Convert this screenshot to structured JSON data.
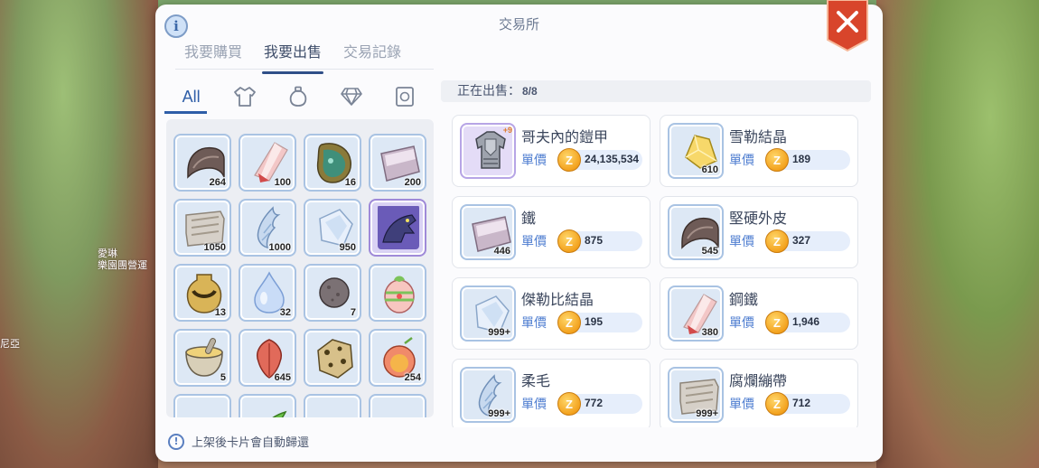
{
  "background": {
    "npc_name": "愛琳",
    "npc_guild": "樂園團營運",
    "left_edge_text": "尼亞"
  },
  "dialog": {
    "title": "交易所",
    "info_icon": "i",
    "close_icon": "×"
  },
  "tabs": [
    {
      "label": "我要購買",
      "active": false
    },
    {
      "label": "我要出售",
      "active": true
    },
    {
      "label": "交易記錄",
      "active": false
    }
  ],
  "categories": [
    {
      "label": "All",
      "icon": "all",
      "active": true
    },
    {
      "label": "",
      "icon": "armor-icon",
      "active": false
    },
    {
      "label": "",
      "icon": "consumable-icon",
      "active": false
    },
    {
      "label": "",
      "icon": "gem-icon",
      "active": false
    },
    {
      "label": "",
      "icon": "card-icon",
      "active": false
    }
  ],
  "inventory": [
    {
      "item": "hard-shell",
      "qty": "264"
    },
    {
      "item": "steel",
      "qty": "100"
    },
    {
      "item": "green-stone",
      "qty": "16"
    },
    {
      "item": "iron",
      "qty": "200"
    },
    {
      "item": "bandage",
      "qty": "1050"
    },
    {
      "item": "fur",
      "qty": "1000"
    },
    {
      "item": "zebris-crystal",
      "qty": "950"
    },
    {
      "item": "wolf-card",
      "qty": ""
    },
    {
      "item": "jar",
      "qty": "13"
    },
    {
      "item": "water-drop",
      "qty": "32"
    },
    {
      "item": "stone-ball",
      "qty": "7"
    },
    {
      "item": "easter-egg",
      "qty": ""
    },
    {
      "item": "mortar",
      "qty": "5"
    },
    {
      "item": "red-herb",
      "qty": "645"
    },
    {
      "item": "leopard-rock",
      "qty": ""
    },
    {
      "item": "apple-juice",
      "qty": "254"
    },
    {
      "item": "yellow-powder",
      "qty": ""
    },
    {
      "item": "green-leaf",
      "qty": ""
    },
    {
      "item": "grey-item",
      "qty": ""
    },
    {
      "item": "red-item",
      "qty": ""
    }
  ],
  "footer": {
    "icon": "!",
    "text": "上架後卡片會自動歸還"
  },
  "selling": {
    "label": "正在出售：",
    "count": "8/8",
    "price_label": "單價",
    "coin_symbol": "Z",
    "listings": [
      {
        "name": "哥夫內的鎧甲",
        "qty": "",
        "enhance": "+9",
        "price": "24,135,534",
        "icon": "armor",
        "rarity": "purple"
      },
      {
        "name": "雪勒結晶",
        "qty": "610",
        "enhance": "",
        "price": "189",
        "icon": "yellow-crystal",
        "rarity": "blue"
      },
      {
        "name": "鐵",
        "qty": "446",
        "enhance": "",
        "price": "875",
        "icon": "iron",
        "rarity": "blue"
      },
      {
        "name": "堅硬外皮",
        "qty": "545",
        "enhance": "",
        "price": "327",
        "icon": "hard-shell",
        "rarity": "blue"
      },
      {
        "name": "傑勒比結晶",
        "qty": "999+",
        "enhance": "",
        "price": "195",
        "icon": "zebris-crystal",
        "rarity": "blue"
      },
      {
        "name": "鋼鐵",
        "qty": "380",
        "enhance": "",
        "price": "1,946",
        "icon": "steel",
        "rarity": "blue"
      },
      {
        "name": "柔毛",
        "qty": "999+",
        "enhance": "",
        "price": "772",
        "icon": "fur",
        "rarity": "blue"
      },
      {
        "name": "腐爛繃帶",
        "qty": "999+",
        "enhance": "",
        "price": "712",
        "icon": "bandage",
        "rarity": "blue"
      }
    ]
  },
  "colors": {
    "accent": "#2f5ea8",
    "close_red": "#d8452b",
    "coin": "#f3a21e"
  }
}
